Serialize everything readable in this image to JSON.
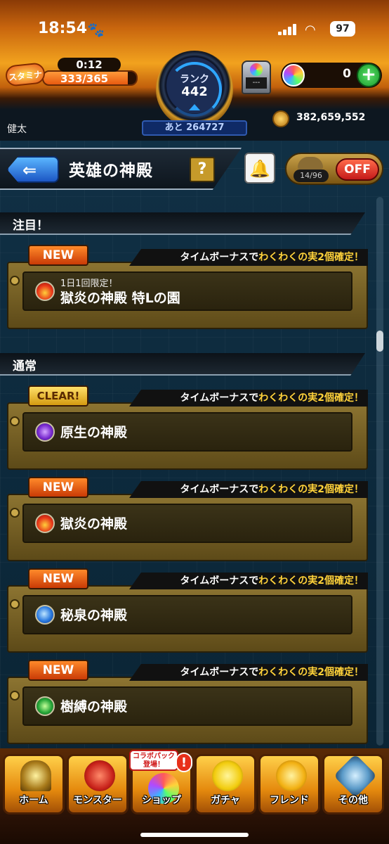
{
  "status": {
    "time": "18:54",
    "battery": "97"
  },
  "header": {
    "stamina_label": "スタミナ",
    "stamina_timer": "0:12",
    "stamina_value": "333/365",
    "stamina_fraction": 0.912,
    "rank_label": "ランク",
    "rank_value": "442",
    "next_rank": "あと 264727",
    "capsule_text": "---",
    "orb_count": "0",
    "user_name": "健太",
    "coins": "382,659,552"
  },
  "title": {
    "text": "英雄の神殿",
    "help": "?",
    "toggle_count": "14/96",
    "toggle_state": "OFF"
  },
  "sections": {
    "featured": "注目！",
    "normal": "通常"
  },
  "bonus": {
    "prefix": "タイムボーナスで",
    "highlight": "わくわくの実2個確定！"
  },
  "cards": [
    {
      "badge": "NEW",
      "sub": "1日1回限定！",
      "name": "獄炎の神殿 特Lの園",
      "element": "fire"
    },
    {
      "badge": "CLEAR!",
      "name": "原生の神殿",
      "element": "dark"
    },
    {
      "badge": "NEW",
      "name": "獄炎の神殿",
      "element": "fire"
    },
    {
      "badge": "NEW",
      "name": "秘泉の神殿",
      "element": "water"
    },
    {
      "badge": "NEW",
      "name": "樹縛の神殿",
      "element": "wood"
    }
  ],
  "nav": {
    "items": [
      {
        "label": "ホーム"
      },
      {
        "label": "モンスター"
      },
      {
        "label": "ショップ"
      },
      {
        "label": "ガチャ"
      },
      {
        "label": "フレンド"
      },
      {
        "label": "その他"
      }
    ],
    "promo": "コラボパック登場！",
    "alert": "!"
  }
}
